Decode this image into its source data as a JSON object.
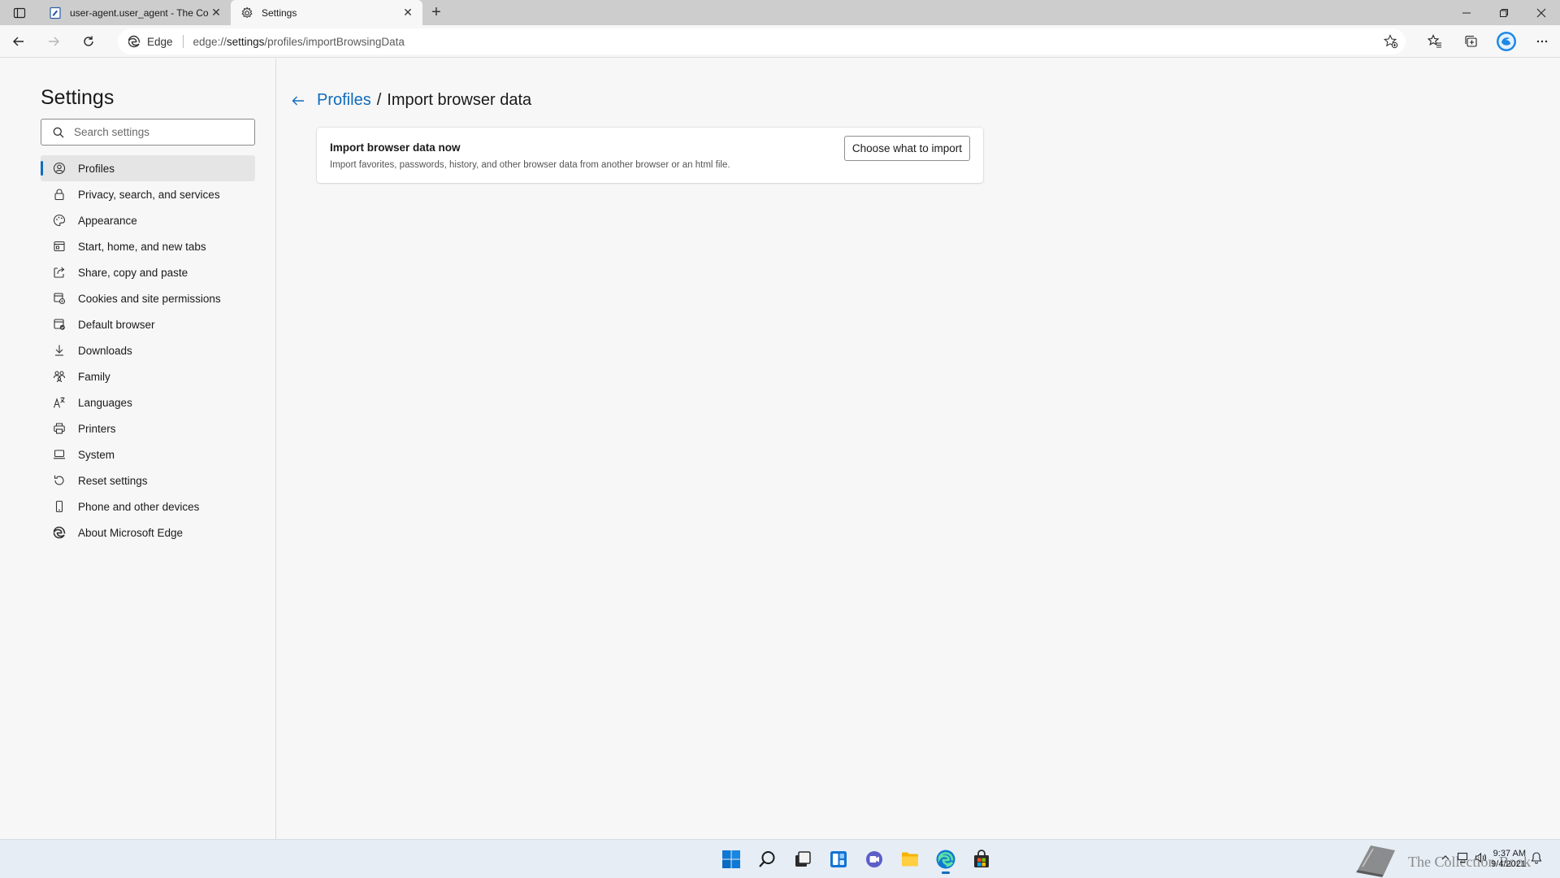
{
  "tabs": [
    {
      "title": "user-agent.user_agent - The Collection Book",
      "active": false,
      "icon": "page-icon"
    },
    {
      "title": "Settings",
      "active": true,
      "icon": "gear-icon"
    }
  ],
  "address_bar": {
    "site_label": "Edge",
    "url_prefix": "edge://",
    "url_highlight": "settings",
    "url_rest": "/profiles/importBrowsingData"
  },
  "sidebar": {
    "title": "Settings",
    "search_placeholder": "Search settings",
    "items": [
      {
        "label": "Profiles",
        "icon": "profile-icon",
        "selected": true
      },
      {
        "label": "Privacy, search, and services",
        "icon": "lock-icon"
      },
      {
        "label": "Appearance",
        "icon": "palette-icon"
      },
      {
        "label": "Start, home, and new tabs",
        "icon": "home-tabs-icon"
      },
      {
        "label": "Share, copy and paste",
        "icon": "share-icon"
      },
      {
        "label": "Cookies and site permissions",
        "icon": "cookies-icon"
      },
      {
        "label": "Default browser",
        "icon": "default-browser-icon"
      },
      {
        "label": "Downloads",
        "icon": "download-icon"
      },
      {
        "label": "Family",
        "icon": "family-icon"
      },
      {
        "label": "Languages",
        "icon": "languages-icon"
      },
      {
        "label": "Printers",
        "icon": "printer-icon"
      },
      {
        "label": "System",
        "icon": "laptop-icon"
      },
      {
        "label": "Reset settings",
        "icon": "reset-icon"
      },
      {
        "label": "Phone and other devices",
        "icon": "phone-icon"
      },
      {
        "label": "About Microsoft Edge",
        "icon": "edge-icon"
      }
    ]
  },
  "main": {
    "breadcrumb_parent": "Profiles",
    "breadcrumb_separator": "/",
    "breadcrumb_current": "Import browser data",
    "card": {
      "title": "Import browser data now",
      "description": "Import favorites, passwords, history, and other browser data from another browser or an html file.",
      "button_label": "Choose what to import"
    }
  },
  "taskbar": {
    "watermark_text": "The Collection Book",
    "time": "9:37 AM",
    "date": "9/4/2021"
  },
  "colors": {
    "accent": "#0f6cbd",
    "tabstrip": "#cdcdcd",
    "taskbar": "#e6edf5"
  }
}
